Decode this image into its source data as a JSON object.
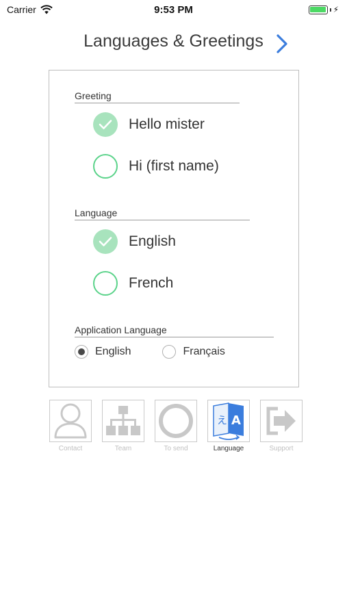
{
  "status_bar": {
    "carrier": "Carrier",
    "time": "9:53 PM"
  },
  "header": {
    "title": "Languages & Greetings"
  },
  "greeting": {
    "label": "Greeting",
    "options": [
      {
        "label": "Hello mister",
        "checked": true
      },
      {
        "label": "Hi (first name)",
        "checked": false
      }
    ]
  },
  "language": {
    "label": "Language",
    "options": [
      {
        "label": "English",
        "checked": true
      },
      {
        "label": "French",
        "checked": false
      }
    ]
  },
  "app_language": {
    "label": "Application Language",
    "options": [
      {
        "label": "English",
        "selected": true
      },
      {
        "label": "Français",
        "selected": false
      }
    ]
  },
  "tabs": [
    {
      "label": "Contact",
      "icon": "person-icon",
      "active": false
    },
    {
      "label": "Team",
      "icon": "org-chart-icon",
      "active": false
    },
    {
      "label": "To send",
      "icon": "ring-icon",
      "active": false
    },
    {
      "label": "Language",
      "icon": "translate-icon",
      "active": true
    },
    {
      "label": "Support",
      "icon": "exit-arrow-icon",
      "active": false
    }
  ],
  "colors": {
    "accent_blue": "#3b7ddd",
    "check_fill": "#a8e3bd",
    "check_outline": "#5bd38a",
    "battery": "#4cd964",
    "inactive_icon": "#c8c8c8"
  }
}
